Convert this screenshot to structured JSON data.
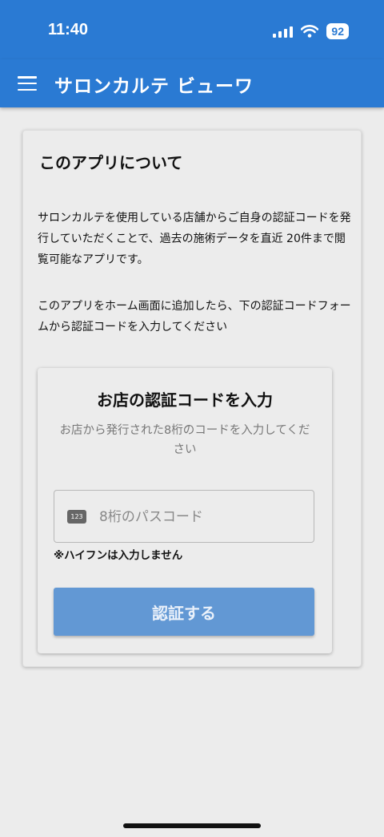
{
  "status_bar": {
    "time": "11:40",
    "battery": "92",
    "icons": [
      "signal-icon",
      "wifi-icon",
      "battery-icon"
    ]
  },
  "app_bar": {
    "title": "サロンカルテ ビューワ",
    "menu_icon": "menu-icon"
  },
  "about": {
    "title": "このアプリについて",
    "paragraph1": "サロンカルテを使用している店舗からご自身の認証コードを発行していただくことで、過去の施術データを直近 20件まで閲覧可能なアプリです。",
    "paragraph2": "このアプリをホーム画面に追加したら、下の認証コードフォームから認証コードを入力してください"
  },
  "auth_form": {
    "title": "お店の認証コードを入力",
    "subtitle": "お店から発行された8桁のコードを入力してください",
    "input_icon_text": "123",
    "input_value": "",
    "input_placeholder": "8桁のパスコード",
    "hint": "※ハイフンは入力しません",
    "submit_label": "認証する"
  },
  "colors": {
    "accent": "#2a7ad3",
    "button": "#6298d4",
    "background": "#ececec"
  }
}
